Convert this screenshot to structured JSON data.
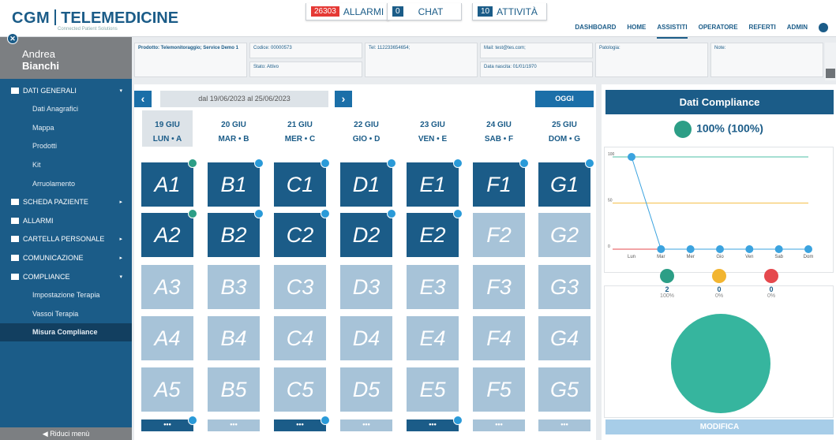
{
  "header": {
    "logo_cgm": "CGM",
    "logo_tele": "TELEMEDICINE",
    "logo_sub": "Connected Patient Solutions",
    "allarmi_count": "26303",
    "allarmi_label": "ALLARMI",
    "chat_count": "0",
    "chat_label": "CHAT",
    "attivita_count": "10",
    "attivita_label": "ATTIVITÀ",
    "nav": [
      "DASHBOARD",
      "HOME",
      "ASSISTITI",
      "OPERATORE",
      "REFERTI",
      "ADMIN"
    ],
    "nav_active": "ASSISTITI"
  },
  "patient": {
    "first_name": "Andrea",
    "last_name": "Bianchi"
  },
  "sidebar": {
    "items": [
      {
        "label": "DATI GENERALI",
        "type": "section",
        "arrow": "▾"
      },
      {
        "label": "Dati Anagrafici",
        "type": "sub"
      },
      {
        "label": "Mappa",
        "type": "sub"
      },
      {
        "label": "Prodotti",
        "type": "sub"
      },
      {
        "label": "Kit",
        "type": "sub"
      },
      {
        "label": "Arruolamento",
        "type": "sub"
      },
      {
        "label": "SCHEDA PAZIENTE",
        "type": "section",
        "arrow": "▸"
      },
      {
        "label": "ALLARMI",
        "type": "section",
        "arrow": ""
      },
      {
        "label": "CARTELLA PERSONALE",
        "type": "section",
        "arrow": "▸"
      },
      {
        "label": "COMUNICAZIONE",
        "type": "section",
        "arrow": "▸"
      },
      {
        "label": "COMPLIANCE",
        "type": "section",
        "arrow": "▾"
      },
      {
        "label": "Impostazione Terapia",
        "type": "sub"
      },
      {
        "label": "Vassoi Terapia",
        "type": "sub"
      },
      {
        "label": "Misura Compliance",
        "type": "sub",
        "selected": true
      }
    ],
    "collapse_label": "Riduci menù"
  },
  "info": {
    "prodotto": "Prodotto: Telemonitoraggio; Service Demo 1",
    "codice": "Codice: 00000573",
    "stato": "Stato: Attivo",
    "tel": "Tel: 112233654654;",
    "mail": "Mail: test@tes.com;",
    "nascita": "Data nascita: 01/01/1970",
    "patologia": "Patologia:",
    "note": "Note:"
  },
  "calendar": {
    "prev": "‹",
    "next": "›",
    "range": "dal 19/06/2023 al 25/06/2023",
    "today_label": "OGGI",
    "days": [
      {
        "date": "19 GIU",
        "weekday": "LUN • A",
        "today": true
      },
      {
        "date": "20 GIU",
        "weekday": "MAR • B"
      },
      {
        "date": "21 GIU",
        "weekday": "MER • C"
      },
      {
        "date": "22 GIU",
        "weekday": "GIO • D"
      },
      {
        "date": "23 GIU",
        "weekday": "VEN • E"
      },
      {
        "date": "24 GIU",
        "weekday": "SAB • F"
      },
      {
        "date": "25 GIU",
        "weekday": "DOM • G"
      }
    ],
    "rows": [
      [
        {
          "label": "A1",
          "state": "dark",
          "dot": "smile"
        },
        {
          "label": "B1",
          "state": "dark",
          "dot": "blue"
        },
        {
          "label": "C1",
          "state": "dark",
          "dot": "blue"
        },
        {
          "label": "D1",
          "state": "dark",
          "dot": "blue"
        },
        {
          "label": "E1",
          "state": "dark",
          "dot": "blue"
        },
        {
          "label": "F1",
          "state": "dark",
          "dot": "blue"
        },
        {
          "label": "G1",
          "state": "dark",
          "dot": "blue"
        }
      ],
      [
        {
          "label": "A2",
          "state": "dark",
          "dot": "smile"
        },
        {
          "label": "B2",
          "state": "dark",
          "dot": "blue"
        },
        {
          "label": "C2",
          "state": "dark",
          "dot": "blue"
        },
        {
          "label": "D2",
          "state": "dark",
          "dot": "blue"
        },
        {
          "label": "E2",
          "state": "dark",
          "dot": "blue"
        },
        {
          "label": "F2",
          "state": "light"
        },
        {
          "label": "G2",
          "state": "light"
        }
      ],
      [
        {
          "label": "A3",
          "state": "light"
        },
        {
          "label": "B3",
          "state": "light"
        },
        {
          "label": "C3",
          "state": "light"
        },
        {
          "label": "D3",
          "state": "light"
        },
        {
          "label": "E3",
          "state": "light"
        },
        {
          "label": "F3",
          "state": "light"
        },
        {
          "label": "G3",
          "state": "light"
        }
      ],
      [
        {
          "label": "A4",
          "state": "light"
        },
        {
          "label": "B4",
          "state": "light"
        },
        {
          "label": "C4",
          "state": "light"
        },
        {
          "label": "D4",
          "state": "light"
        },
        {
          "label": "E4",
          "state": "light"
        },
        {
          "label": "F4",
          "state": "light"
        },
        {
          "label": "G4",
          "state": "light"
        }
      ],
      [
        {
          "label": "A5",
          "state": "light"
        },
        {
          "label": "B5",
          "state": "light"
        },
        {
          "label": "C5",
          "state": "light"
        },
        {
          "label": "D5",
          "state": "light"
        },
        {
          "label": "E5",
          "state": "light"
        },
        {
          "label": "F5",
          "state": "light"
        },
        {
          "label": "G5",
          "state": "light"
        }
      ]
    ],
    "more": [
      {
        "label": "•••",
        "state": "dark",
        "dot": true
      },
      {
        "label": "•••",
        "state": "light"
      },
      {
        "label": "•••",
        "state": "dark",
        "dot": true
      },
      {
        "label": "•••",
        "state": "light"
      },
      {
        "label": "•••",
        "state": "dark",
        "dot": true
      },
      {
        "label": "•••",
        "state": "light"
      },
      {
        "label": "•••",
        "state": "light"
      }
    ]
  },
  "compliance": {
    "title": "Dati Compliance",
    "summary": "100% (100%)",
    "happy": {
      "count": "2",
      "pct": "100%"
    },
    "neutral": {
      "count": "0",
      "pct": "0%"
    },
    "sad": {
      "count": "0",
      "pct": "0%"
    },
    "modifica": "MODIFICA",
    "colors": {
      "happy": "#2c9e86",
      "neutral": "#f2b531",
      "sad": "#e5484d",
      "pie": "#36b59e"
    }
  },
  "chart_data": {
    "type": "line",
    "categories": [
      "Lun",
      "Mar",
      "Mer",
      "Gio",
      "Ven",
      "Sab",
      "Dom"
    ],
    "values": [
      100,
      0,
      0,
      0,
      0,
      0,
      0
    ],
    "yticks": [
      "100",
      "50",
      "0"
    ],
    "ylim": [
      0,
      100
    ],
    "reference_lines": [
      {
        "value": 100,
        "color": "#4dbfa5"
      },
      {
        "value": 50,
        "color": "#f5c04a"
      },
      {
        "value": 0,
        "color": "#e5484d"
      }
    ],
    "series_color": "#3ba3df"
  }
}
